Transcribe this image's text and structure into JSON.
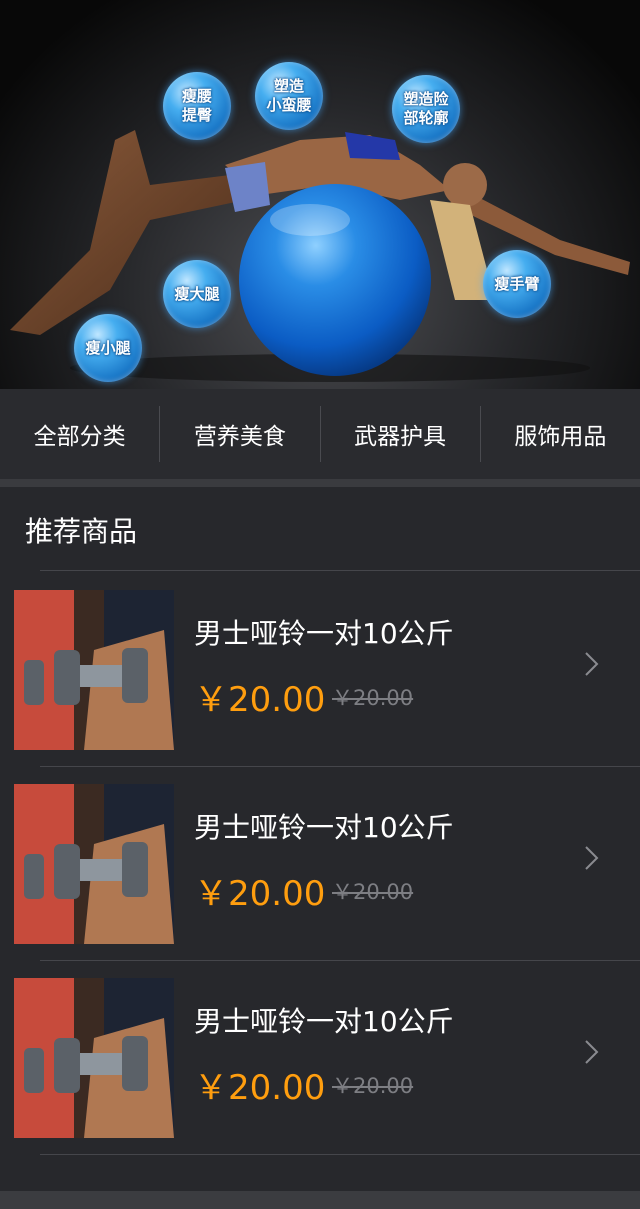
{
  "banner": {
    "image": "fitness-ball-woman-banner",
    "bubbles": [
      {
        "text": "瘦腰\n提臀"
      },
      {
        "text": "塑造\n小蛮腰"
      },
      {
        "text": "塑造险\n部轮廓"
      },
      {
        "text": "瘦大腿"
      },
      {
        "text": "瘦手臂"
      },
      {
        "text": "瘦小腿"
      }
    ]
  },
  "categories": [
    {
      "label": "全部分类"
    },
    {
      "label": "营养美食"
    },
    {
      "label": "武器护具"
    },
    {
      "label": "服饰用品"
    }
  ],
  "section": {
    "title": "推荐商品"
  },
  "products": [
    {
      "name": "男士哑铃一对10公斤",
      "price": "￥20.00",
      "old_price": "￥20.00",
      "image": "dumbbell-photo",
      "icon": "chevron-right-icon"
    },
    {
      "name": "男士哑铃一对10公斤",
      "price": "￥20.00",
      "old_price": "￥20.00",
      "image": "dumbbell-photo",
      "icon": "chevron-right-icon"
    },
    {
      "name": "男士哑铃一对10公斤",
      "price": "￥20.00",
      "old_price": "￥20.00",
      "image": "dumbbell-photo",
      "icon": "chevron-right-icon"
    }
  ],
  "colors": {
    "background": "#27282c",
    "price": "#ff9e0f",
    "old_price": "#7d7e83",
    "accent_blue": "#1e7fd8"
  }
}
